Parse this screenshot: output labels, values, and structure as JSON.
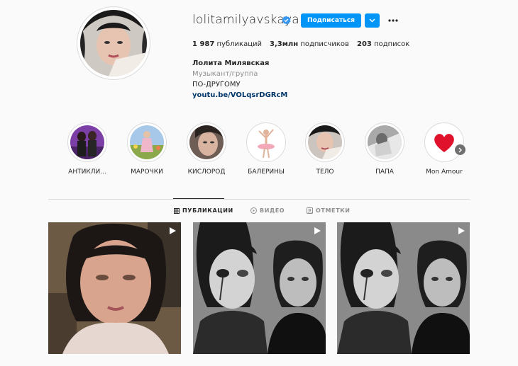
{
  "profile": {
    "username": "lolitamilyavskaya",
    "follow_label": "Подписаться",
    "full_name": "Лолита Милявская",
    "category": "Музыкант/группа",
    "bio": "ПО-ДРУГОМУ",
    "link": "youtu.be/VOLqsrDGRcM"
  },
  "stats": {
    "posts_count": "1 987",
    "posts_label": "публикаций",
    "followers_count": "3,3млн",
    "followers_label": "подписчиков",
    "following_count": "203",
    "following_label": "подписок"
  },
  "highlights": [
    {
      "label": "АНТИКЛИ..."
    },
    {
      "label": "МАРОЧКИ"
    },
    {
      "label": "КИСЛОРОД"
    },
    {
      "label": "БАЛЕРИНЫ"
    },
    {
      "label": "ТЕЛО"
    },
    {
      "label": "ПАПА"
    },
    {
      "label": "Mon Amour"
    }
  ],
  "tabs": {
    "posts": "ПУБЛИКАЦИИ",
    "video": "ВИДЕО",
    "tagged": "ОТМЕТКИ"
  },
  "colors": {
    "accent": "#0095f6",
    "link": "#00376b",
    "secondary_text": "#8e8e8e"
  }
}
